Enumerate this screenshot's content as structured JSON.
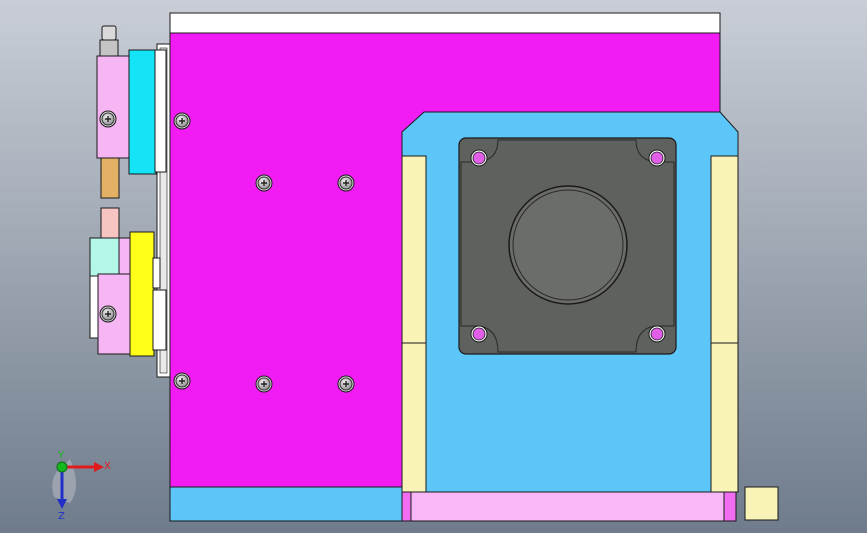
{
  "viewport": {
    "background_top": "#c9ced6",
    "background_bottom": "#6f7c8c"
  },
  "colors": {
    "magenta_plate": "#f21bf3",
    "top_strip": "#ffffff",
    "cyan_block": "#5dc6f8",
    "pink_strip": "#f9b7f7",
    "cream_block": "#f9f3b8",
    "motor_body": "#5f615f",
    "motor_boss": "#6b6d69",
    "hole_fill": "#e15fe6",
    "clamp_pink": "#f6b5f3",
    "clamp_cyan": "#15e4f6",
    "clamp_yellow": "#ffff1a",
    "clamp_mint": "#b4f7e9",
    "spacer_orange": "#e2b166",
    "spacer_pink": "#f6c5c2",
    "screw_grey": "#b8bab8",
    "outline": "#1a1a1a"
  },
  "triad": {
    "x_label": "X",
    "y_label": "Y",
    "z_label": "Z",
    "x_color": "#e11b1b",
    "y_color": "#16b81f",
    "z_color": "#2330c8"
  },
  "icons": [
    "screw-head-icon",
    "countersunk-hole-icon",
    "axis-triad-icon"
  ]
}
